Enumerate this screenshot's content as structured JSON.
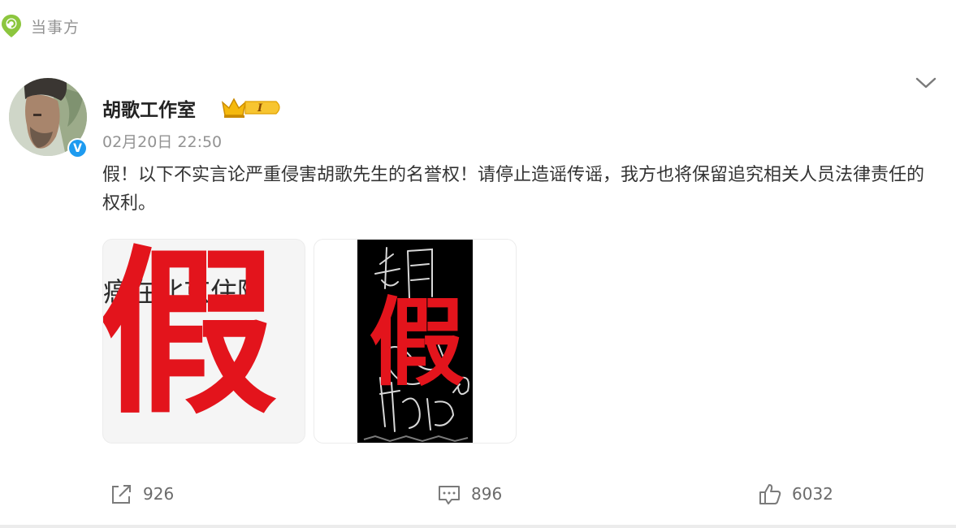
{
  "source_tag": {
    "label": "当事方",
    "icon": "location-pin-icon",
    "color": "#8cc63e"
  },
  "post": {
    "author": {
      "name": "胡歌工作室",
      "verified": true,
      "vip_level": "I"
    },
    "time": "02月20日 22:50",
    "text": "假！以下不实言论严重侵害胡歌先生的名誉权！请停止造谣传谣，我方也将保留追究相关人员法律责任的权利。",
    "images": [
      {
        "caption": "癌在北京住院",
        "overlay": "假"
      },
      {
        "overlay": "假"
      }
    ],
    "actions": {
      "reposts": "926",
      "comments": "896",
      "likes": "6032"
    }
  },
  "colors": {
    "accent_red": "#e3141c",
    "verify_blue": "#1e9bf0",
    "muted_text": "#939393",
    "vip_gold": "#f5b90d"
  }
}
